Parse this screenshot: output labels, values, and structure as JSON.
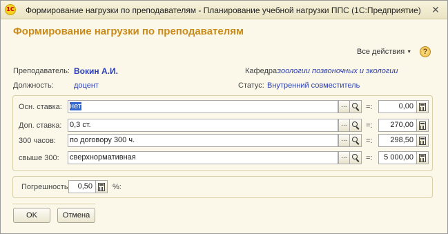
{
  "window": {
    "title": "Формирование нагрузки по преподавателям - Планирование учебной нагрузки ППС  (1С:Предприятие)",
    "app_logo": "1С",
    "close_icon": "close-icon"
  },
  "form": {
    "heading": "Формирование нагрузки по преподавателям",
    "all_actions": "Все действия",
    "help": "?"
  },
  "info": {
    "teacher_label": "Преподаватель:",
    "teacher_value": "Вокин А.И.",
    "department_label": "Кафедра:",
    "department_value": "зоологии позвоночных и экологии",
    "position_label": "Должность:",
    "position_value": "доцент",
    "status_label": "Статус:",
    "status_value": "Внутренний совместитель"
  },
  "rows": [
    {
      "label": "Осн. ставка:",
      "value": "нет",
      "eq": "=:",
      "amount": "0,00"
    },
    {
      "label": "Доп. ставка:",
      "value": "0,3 ст.",
      "eq": "=:",
      "amount": "270,00"
    },
    {
      "label": "300 часов:",
      "value": "по договору 300 ч.",
      "eq": "=:",
      "amount": "298,50"
    },
    {
      "label": "свыше 300:",
      "value": "сверхнормативная",
      "eq": "=:",
      "amount": "5 000,00"
    }
  ],
  "error": {
    "label": "Погрешность:",
    "value": "0,50",
    "unit": "%:"
  },
  "buttons": {
    "ok": "OK",
    "cancel": "Отмена"
  },
  "colors": {
    "heading": "#c98a1a",
    "link": "#2b3fb0",
    "window_bg": "#fbf8ea",
    "selection": "#3366cc"
  }
}
